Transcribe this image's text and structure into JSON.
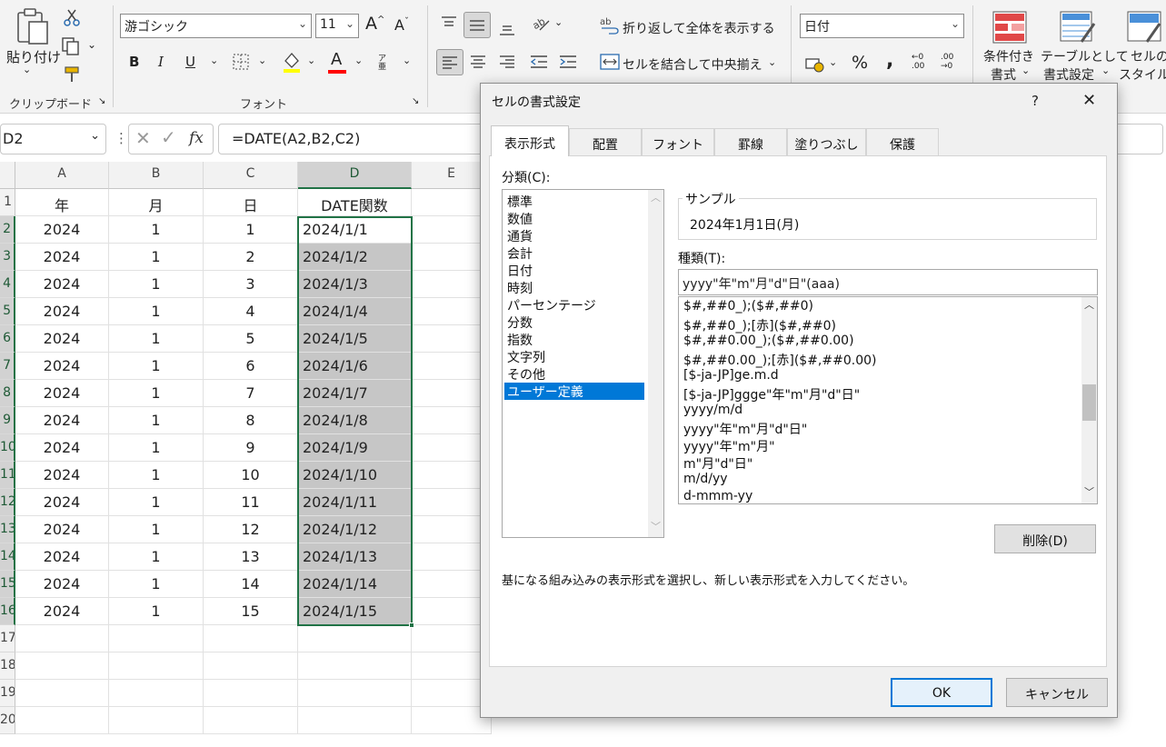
{
  "ribbon": {
    "clipboard": {
      "paste": "貼り付け",
      "label": "クリップボード"
    },
    "font": {
      "family": "游ゴシック",
      "size": "11",
      "label": "フォント",
      "phonetic": "ア亜"
    },
    "alignment": {
      "wrap_text": "折り返して全体を表示する",
      "merge_center": "セルを結合して中央揃え"
    },
    "number": {
      "format": "日付"
    },
    "styles": {
      "conditional_line1": "条件付き",
      "conditional_line2": "書式",
      "table_line1": "テーブルとして",
      "table_line2": "書式設定",
      "cell_line1": "セルの",
      "cell_line2": "スタイル"
    }
  },
  "formula_bar": {
    "name_box": "D2",
    "fx": "fx",
    "formula": "=DATE(A2,B2,C2)"
  },
  "sheet": {
    "columns": [
      "A",
      "B",
      "C",
      "D",
      "E"
    ],
    "headers": [
      "年",
      "月",
      "日",
      "DATE関数"
    ],
    "row_numbers": [
      "1",
      "2",
      "3",
      "4",
      "5",
      "6",
      "7",
      "8",
      "9",
      "10",
      "11",
      "12",
      "13",
      "14",
      "15",
      "16",
      "17",
      "18",
      "19",
      "20"
    ],
    "rows": [
      [
        "2024",
        "1",
        "1",
        "2024/1/1"
      ],
      [
        "2024",
        "1",
        "2",
        "2024/1/2"
      ],
      [
        "2024",
        "1",
        "3",
        "2024/1/3"
      ],
      [
        "2024",
        "1",
        "4",
        "2024/1/4"
      ],
      [
        "2024",
        "1",
        "5",
        "2024/1/5"
      ],
      [
        "2024",
        "1",
        "6",
        "2024/1/6"
      ],
      [
        "2024",
        "1",
        "7",
        "2024/1/7"
      ],
      [
        "2024",
        "1",
        "8",
        "2024/1/8"
      ],
      [
        "2024",
        "1",
        "9",
        "2024/1/9"
      ],
      [
        "2024",
        "1",
        "10",
        "2024/1/10"
      ],
      [
        "2024",
        "1",
        "11",
        "2024/1/11"
      ],
      [
        "2024",
        "1",
        "12",
        "2024/1/12"
      ],
      [
        "2024",
        "1",
        "13",
        "2024/1/13"
      ],
      [
        "2024",
        "1",
        "14",
        "2024/1/14"
      ],
      [
        "2024",
        "1",
        "15",
        "2024/1/15"
      ]
    ]
  },
  "dialog": {
    "title": "セルの書式設定",
    "help": "?",
    "close": "✕",
    "tabs": [
      "表示形式",
      "配置",
      "フォント",
      "罫線",
      "塗りつぶし",
      "保護"
    ],
    "category_label": "分類(C):",
    "categories": [
      "標準",
      "数値",
      "通貨",
      "会計",
      "日付",
      "時刻",
      "パーセンテージ",
      "分数",
      "指数",
      "文字列",
      "その他",
      "ユーザー定義"
    ],
    "selected_category": "ユーザー定義",
    "sample_label": "サンプル",
    "sample_value": "2024年1月1日(月)",
    "type_label": "種類(T):",
    "type_value": "yyyy\"年\"m\"月\"d\"日\"(aaa)",
    "formats": [
      "$#,##0_);($#,##0)",
      "$#,##0_);[赤]($#,##0)",
      "$#,##0.00_);($#,##0.00)",
      "$#,##0.00_);[赤]($#,##0.00)",
      "[$-ja-JP]ge.m.d",
      "[$-ja-JP]ggge\"年\"m\"月\"d\"日\"",
      "yyyy/m/d",
      "yyyy\"年\"m\"月\"d\"日\"",
      "yyyy\"年\"m\"月\"",
      "m\"月\"d\"日\"",
      "m/d/yy",
      "d-mmm-yy"
    ],
    "delete_button": "削除(D)",
    "description": "基になる組み込みの表示形式を選択し、新しい表示形式を入力してください。",
    "ok_button": "OK",
    "cancel_button": "キャンセル"
  },
  "colors": {
    "excel_green": "#217346",
    "selection_blue": "#0078d7"
  }
}
